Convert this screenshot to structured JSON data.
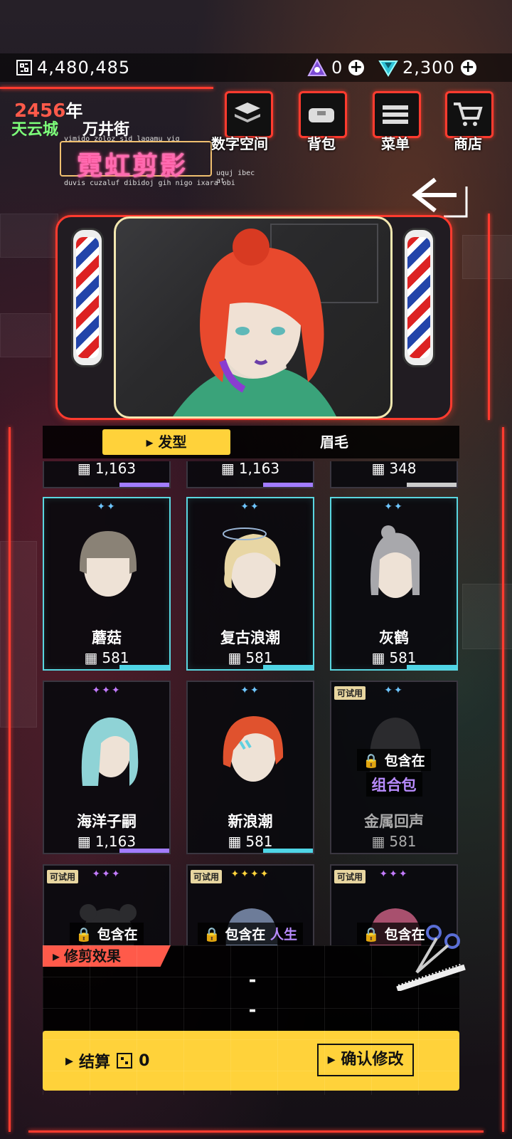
{
  "currencies": {
    "chips": "4,480,485",
    "tokens": "0",
    "gems": "2,300"
  },
  "location": {
    "year": "2456",
    "year_suffix": "年",
    "city": "天云城",
    "street": "万井街"
  },
  "shop": {
    "name": "霓虹剪影",
    "deco_top": "vimido zoloz sid laqamu yiq",
    "deco_right": "uquj ibec at",
    "deco_bottom": "duvis cuzaluf dibidoj gih nigo ixara obi"
  },
  "nav": {
    "digital": "数字空间",
    "bag": "背包",
    "menu": "菜单",
    "store": "商店"
  },
  "tabs": {
    "hair": "发型",
    "eyebrow": "眉毛"
  },
  "partial_prices": [
    "1,163",
    "1,163",
    "348"
  ],
  "items": [
    {
      "name": "蘑菇",
      "price": "581",
      "stars": "✦✦",
      "color": "#c9c2b8"
    },
    {
      "name": "复古浪潮",
      "price": "581",
      "stars": "✦✦",
      "color": "#e8d6a4"
    },
    {
      "name": "灰鹤",
      "price": "581",
      "stars": "✦✦",
      "color": "#a8a8ac"
    },
    {
      "name": "海洋子嗣",
      "price": "1,163",
      "stars": "✦✦✦",
      "color": "#8fd3d6"
    },
    {
      "name": "新浪潮",
      "price": "581",
      "stars": "✦✦",
      "color": "#e0522e"
    },
    {
      "name": "金属回声",
      "price": "581",
      "stars": "✦✦",
      "color": "#333"
    }
  ],
  "lock": {
    "line1": "包含在",
    "line2": "组合包",
    "trial": "可试用"
  },
  "bottom_row": {
    "stars": [
      "✦✦✦",
      "✦✦✦✦",
      "✦✦✦"
    ],
    "lock1": "包含在",
    "lock2": "包含在",
    "lock2_extra": "人生",
    "lock3": "包含在"
  },
  "effect": {
    "title": "修剪效果",
    "value1": "-",
    "value2": "-"
  },
  "checkout": {
    "label": "结算",
    "amount": "0",
    "confirm": "确认修改"
  }
}
